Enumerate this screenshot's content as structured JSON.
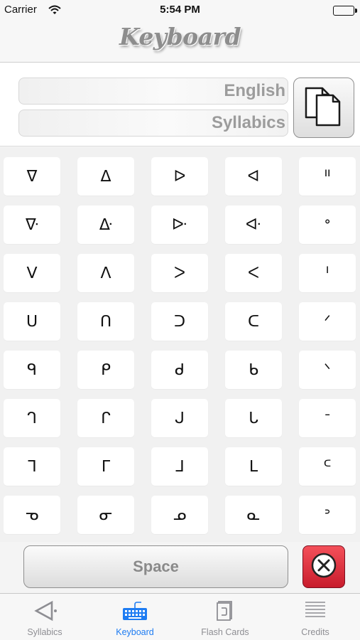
{
  "status_bar": {
    "carrier": "Carrier",
    "time": "5:54 PM"
  },
  "nav": {
    "title": "Keyboard"
  },
  "fields": {
    "english_placeholder": "English",
    "syllabics_placeholder": "Syllabics"
  },
  "keys": [
    [
      "ᐁ",
      "ᐃ",
      "ᐅ",
      "ᐊ",
      "ᐦ"
    ],
    [
      "ᐍ",
      "ᐏ",
      "ᐓ",
      "ᐘ",
      "ᐤ"
    ],
    [
      "ᐯ",
      "ᐱ",
      "ᐳ",
      "ᐸ",
      "ᑊ"
    ],
    [
      "ᑌ",
      "ᑎ",
      "ᑐ",
      "ᑕ",
      "ᐟ"
    ],
    [
      "ᑫ",
      "ᑭ",
      "ᑯ",
      "ᑲ",
      "ᐠ"
    ],
    [
      "ᒉ",
      "ᒋ",
      "ᒍ",
      "ᒐ",
      "ᐨ"
    ],
    [
      "ᒣ",
      "ᒥ",
      "ᒧ",
      "ᒪ",
      "ᒼ"
    ],
    [
      "ᓀ",
      "ᓂ",
      "ᓄ",
      "ᓇ",
      "ᐣ"
    ]
  ],
  "bottom": {
    "space_label": "Space"
  },
  "tabs": [
    {
      "label": "Syllabics",
      "icon": "syllabics-icon",
      "active": false
    },
    {
      "label": "Keyboard",
      "icon": "keyboard-icon",
      "active": true
    },
    {
      "label": "Flash Cards",
      "icon": "flash-cards-icon",
      "active": false
    },
    {
      "label": "Credits",
      "icon": "credits-icon",
      "active": false
    }
  ],
  "colors": {
    "accent": "#1e7cf2",
    "delete": "#e0303c",
    "tab_inactive": "#8e8e93"
  }
}
